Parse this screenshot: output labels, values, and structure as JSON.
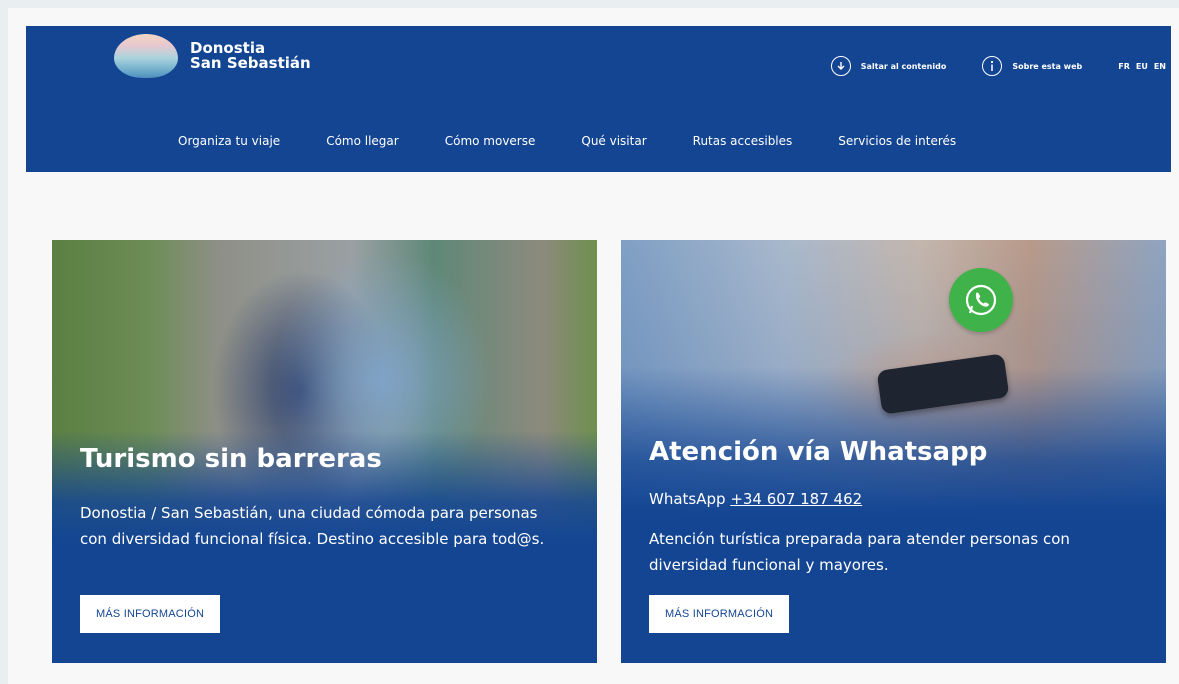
{
  "header": {
    "logo_line1": "Donostia",
    "logo_line2": "San Sebastián",
    "skip_label": "Saltar al contenido",
    "about_label": "Sobre esta web",
    "languages": [
      "FR",
      "EU",
      "EN"
    ]
  },
  "nav": {
    "items": [
      "Organiza tu viaje",
      "Cómo llegar",
      "Cómo moverse",
      "Qué visitar",
      "Rutas accesibles",
      "Servicios de interés"
    ]
  },
  "cards": [
    {
      "title": "Turismo sin barreras",
      "text": "Donostia / San Sebastián, una ciudad cómoda para personas con diversidad funcional física. Destino accesible para tod@s.",
      "button": "MÁS INFORMACIÓN"
    },
    {
      "title": "Atención vía Whatsapp",
      "phone_prefix": "WhatsApp",
      "phone": "+34 607 187 462",
      "text": "Atención turística preparada para atender personas con diversidad funcional y mayores.",
      "button": "MÁS INFORMACIÓN"
    }
  ],
  "colors": {
    "brand_blue": "#134593",
    "whatsapp_green": "#3fb24a",
    "page_background": "#f8f8f8"
  },
  "icons": [
    "download-arrow-icon",
    "info-icon",
    "whatsapp-icon"
  ]
}
